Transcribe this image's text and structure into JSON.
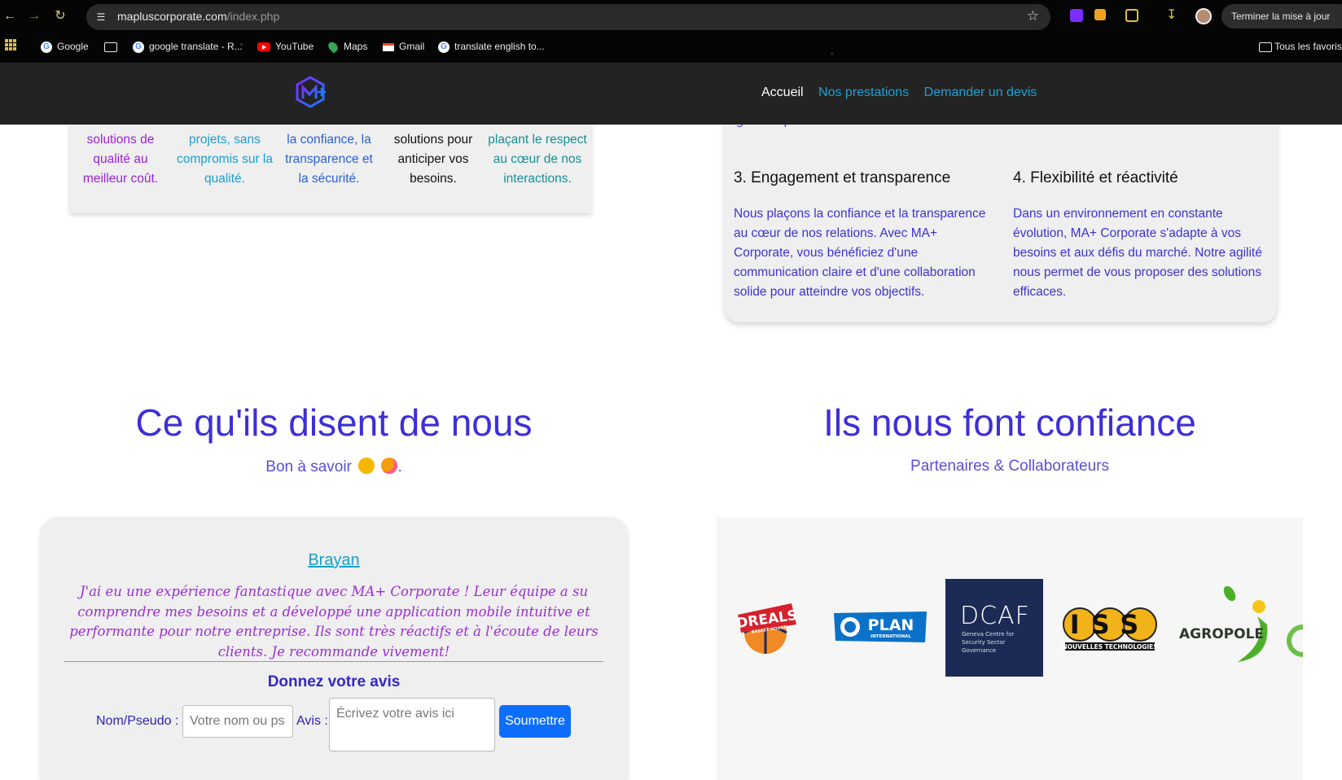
{
  "browser": {
    "url_host": "mapluscorporate.com",
    "url_path": "/index.php",
    "update_button": "Terminer la mise à jour",
    "bookmarks": [
      {
        "label": "Google",
        "icon": "google-icon"
      },
      {
        "label": "google translate - R...",
        "icon": "google-icon"
      },
      {
        "label": "YouTube",
        "icon": "youtube-icon"
      },
      {
        "label": "Maps",
        "icon": "maps-icon"
      },
      {
        "label": "Gmail",
        "icon": "gmail-icon"
      },
      {
        "label": "translate english to...",
        "icon": "google-icon"
      }
    ],
    "all_bookmarks": "Tous les favoris"
  },
  "header": {
    "nav": [
      "Accueil",
      "Nos prestations",
      "Demander un devis"
    ]
  },
  "values_card": {
    "columns": [
      {
        "lines": "solutions de qualité au meilleur coût.",
        "color": "#9b22d6"
      },
      {
        "lines": "projets, sans compromis sur la qualité.",
        "color": "#1a9fcf"
      },
      {
        "lines": "la confiance, la transparence et la sécurité.",
        "color": "#2a5fd8"
      },
      {
        "lines": "solutions pour anticiper vos besoins.",
        "color": "#111111"
      },
      {
        "lines": "plaçant le respect au cœur de nos interactions.",
        "color": "#168f95"
      }
    ]
  },
  "features_card": {
    "cut_text": "rigoureux pour maximiser vos résultats.",
    "items": [
      {
        "title": "3. Engagement et transparence",
        "text": "Nous plaçons la confiance et la transparence au cœur de nos relations. Avec MA+ Corporate, vous bénéficiez d'une communication claire et d'une collaboration solide pour atteindre vos objectifs."
      },
      {
        "title": "4. Flexibilité et réactivité",
        "text": "Dans un environnement en constante évolution, MA+ Corporate s'adapte à vos besoins et aux défis du marché. Notre agilité nous permet de vous proposer des solutions efficaces."
      }
    ]
  },
  "testimonials": {
    "title": "Ce qu'ils disent de nous",
    "subtitle": "Bon à savoir",
    "subtitle_end": ".",
    "review": {
      "name": "Brayan",
      "quote": "J'ai eu une expérience fantastique avec MA+ Corporate ! Leur équipe a su comprendre mes besoins et a développé une application mobile intuitive et performante pour notre entreprise. Ils sont très réactifs et à l'écoute de leurs clients. Je recommande vivement!"
    },
    "form": {
      "title": "Donnez votre avis",
      "name_label": "Nom/Pseudo :",
      "name_placeholder": "Votre nom ou ps",
      "review_label": "Avis :",
      "review_placeholder": "Écrivez votre avis ici",
      "submit": "Soumettre"
    }
  },
  "partners": {
    "title": "Ils nous font confiance",
    "subtitle": "Partenaires & Collaborateurs",
    "logos": [
      {
        "name": "DREALS",
        "caption": "BASKET HOUSE"
      },
      {
        "name": "PLAN",
        "caption": "INTERNATIONAL"
      },
      {
        "name": "DCAF",
        "caption": "Geneva Centre for Security Sector Governance"
      },
      {
        "name": "ISS",
        "caption": "NOUVELLES TECHNOLOGIES"
      },
      {
        "name": "AGROPOLE",
        "caption": ""
      }
    ]
  },
  "colors": {
    "brand_blue": "#3d2fd8",
    "link_cyan": "#1da1d6",
    "submit_blue": "#0d6efd",
    "header_bg": "#232323"
  }
}
